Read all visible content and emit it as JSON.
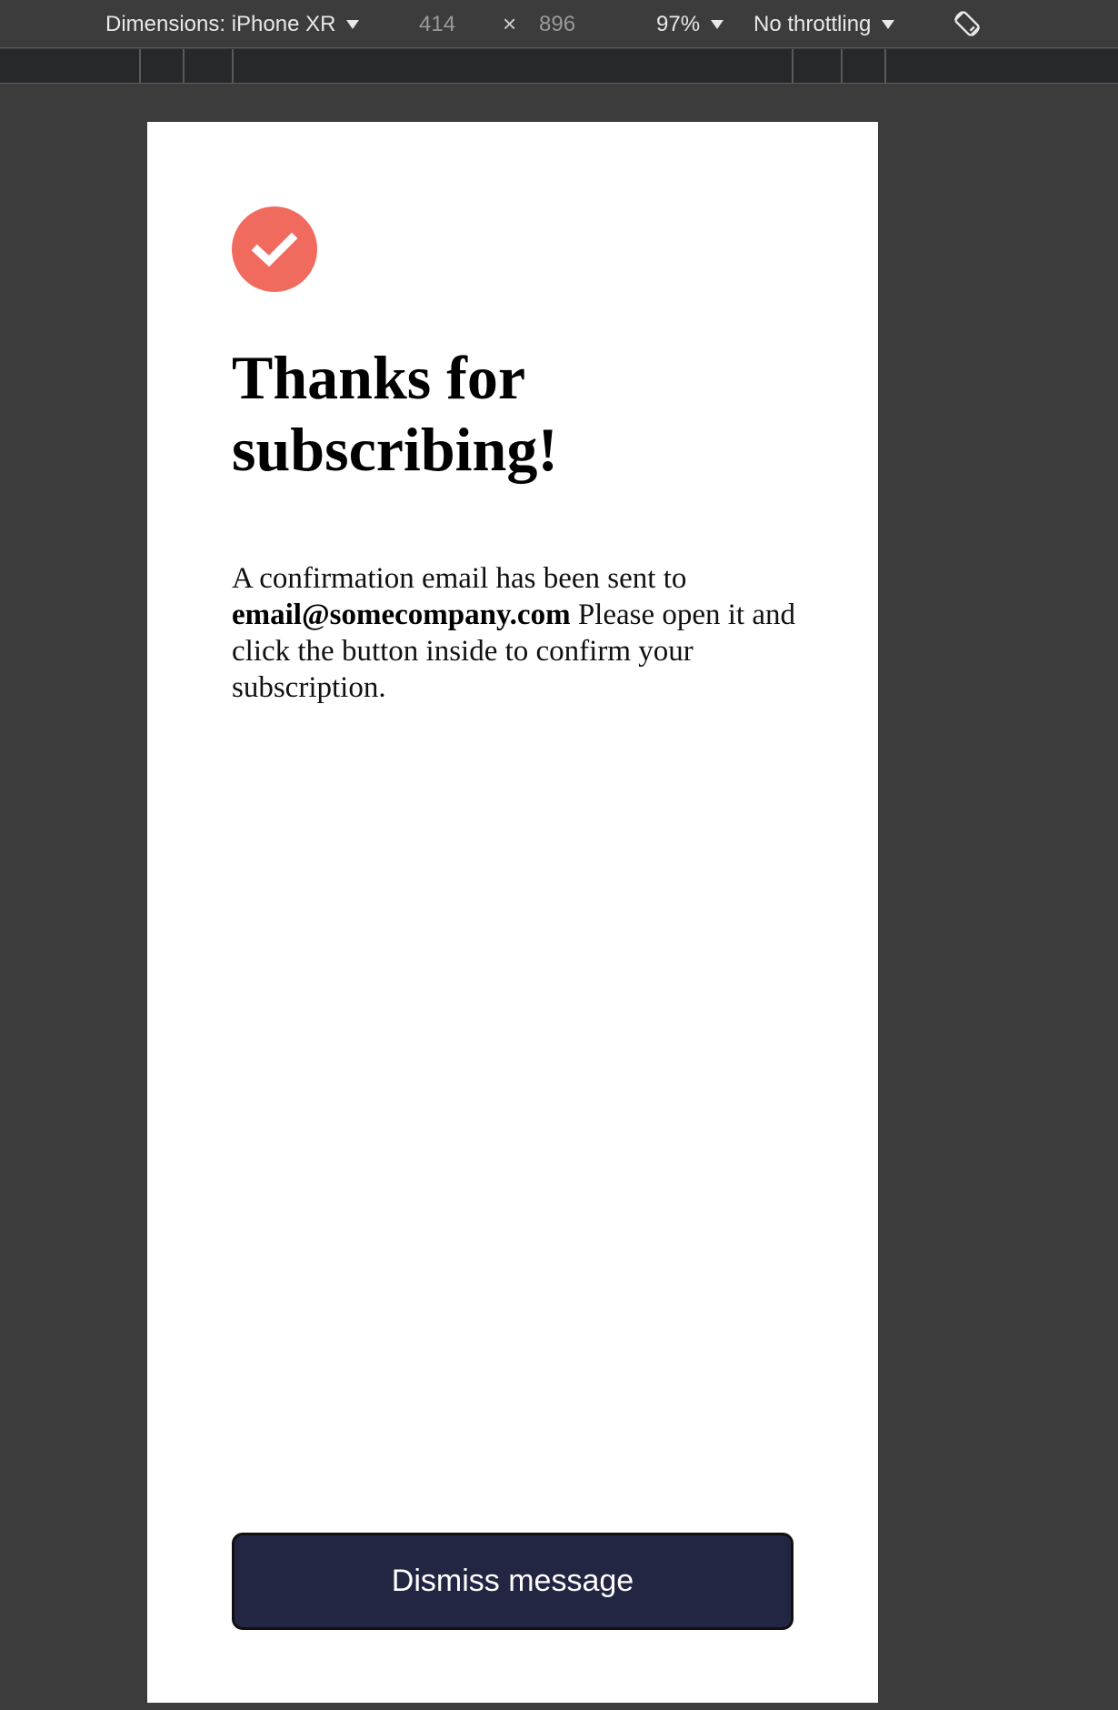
{
  "devtools": {
    "dimensions_label": "Dimensions: iPhone XR",
    "width_value": "414",
    "times_sign": "×",
    "height_value": "896",
    "zoom": "97%",
    "throttling": "No throttling",
    "rotate_icon": "rotate-icon"
  },
  "page": {
    "icon": "check-icon",
    "icon_color": "#f06b5e",
    "title_line1": "Thanks for",
    "title_line2": "subscribing!",
    "message_before": "A confirmation email has been sent to",
    "email": "email@somecompany.com",
    "message_after": "Please open it and click the button inside to confirm your subscription.",
    "dismiss_label": "Dismiss message",
    "button_color": "#232643"
  }
}
